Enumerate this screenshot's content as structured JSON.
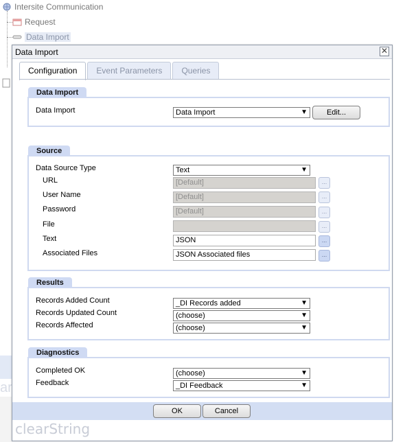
{
  "tree": {
    "root_label": "Intersite Communication",
    "child_request": "Request",
    "child_data_import": "Data Import"
  },
  "background": {
    "watermark_fragment": "ar"
  },
  "dialog": {
    "title": "Data Import",
    "tabs": [
      {
        "label": "Configuration",
        "active": true
      },
      {
        "label": "Event Parameters",
        "active": false
      },
      {
        "label": "Queries",
        "active": false
      }
    ],
    "data_import_group": {
      "heading": "Data Import",
      "field_label": "Data Import",
      "selected_value": "Data Import",
      "edit_button": "Edit..."
    },
    "source_group": {
      "heading": "Source",
      "data_source_type_label": "Data Source Type",
      "data_source_type_value": "Text",
      "url_label": "URL",
      "url_value": "[Default]",
      "user_name_label": "User Name",
      "user_name_value": "[Default]",
      "password_label": "Password",
      "password_value": "[Default]",
      "file_label": "File",
      "file_value": "",
      "text_label": "Text",
      "text_value": "JSON",
      "associated_files_label": "Associated Files",
      "associated_files_value": "JSON Associated files",
      "dots": "..."
    },
    "results_group": {
      "heading": "Results",
      "records_added_label": "Records Added Count",
      "records_added_value": "_DI Records added",
      "records_updated_label": "Records Updated Count",
      "records_updated_value": "(choose)",
      "records_affected_label": "Records Affected",
      "records_affected_value": "(choose)"
    },
    "diagnostics_group": {
      "heading": "Diagnostics",
      "completed_ok_label": "Completed OK",
      "completed_ok_value": "(choose)",
      "feedback_label": "Feedback",
      "feedback_value": "_DI Feedback"
    },
    "ok_button": "OK",
    "cancel_button": "Cancel",
    "brand": "clearString"
  },
  "colors": {
    "group_header_bg": "#cfdaf3",
    "footer_bg": "#d3def3",
    "disabled_input_bg": "#d5d3cf"
  },
  "icons": {
    "root": "globe-icon",
    "request": "calendar-icon",
    "data_import": "link-icon",
    "close": "close-icon",
    "dropdown": "chevron-down-icon"
  }
}
